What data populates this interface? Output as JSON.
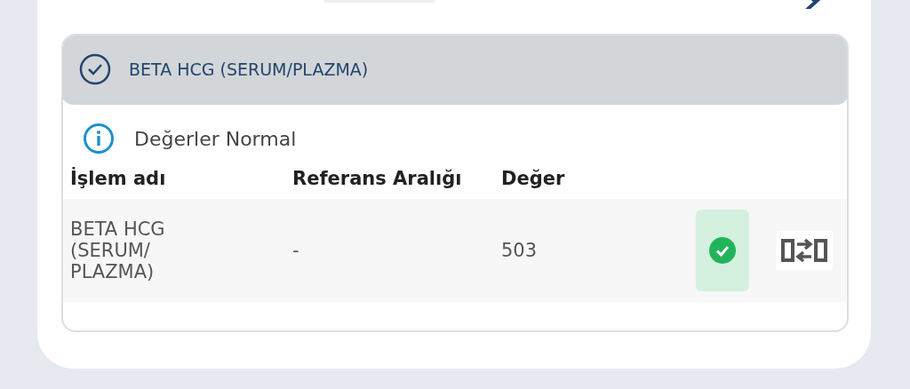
{
  "test": {
    "title": "BETA HCG (SERUM/PLAZMA)",
    "checked": true
  },
  "info": "Değerler Normal",
  "table": {
    "columns": [
      "İşlem adı",
      "Referans Aralığı",
      "Değer"
    ],
    "rows": [
      {
        "name": "BETA HCG (SERUM/ PLAZMA)",
        "reference": "-",
        "value": "503",
        "normal": true
      }
    ]
  }
}
